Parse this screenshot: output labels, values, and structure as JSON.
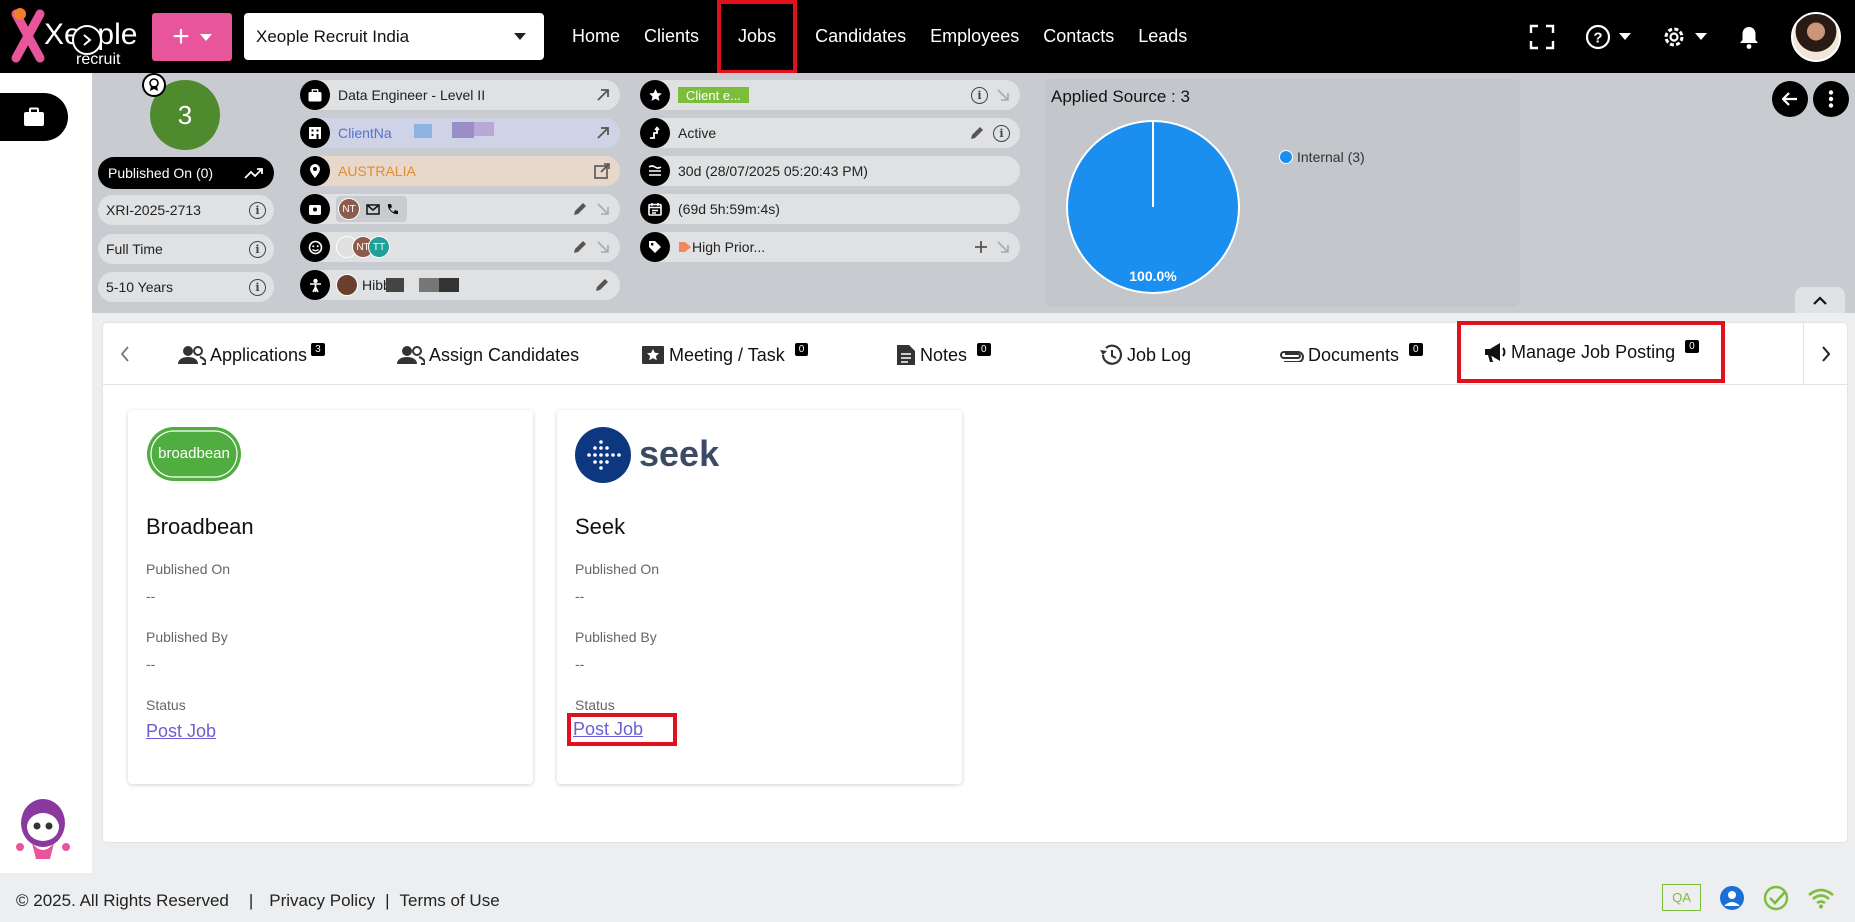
{
  "header": {
    "logo_text": "Xeople",
    "logo_sub": "recruit",
    "org_select": "Xeople Recruit India",
    "nav": [
      "Home",
      "Clients",
      "Jobs",
      "Candidates",
      "Employees",
      "Contacts",
      "Leads"
    ],
    "active_nav": "Jobs"
  },
  "summary": {
    "score": "3",
    "published_on": "Published On (0)",
    "job_code": "XRI-2025-2713",
    "job_type": "Full Time",
    "experience": "5-10 Years",
    "job_title": "Data Engineer - Level II",
    "client_name": "ClientNa",
    "location": "AUSTRALIA",
    "owner_chip": "NT",
    "team_chips": [
      "NT",
      "TT"
    ],
    "contact_name": "Hibb",
    "client_engagement": "Client e...",
    "status": "Active",
    "age": "30d (28/07/2025 05:20:43 PM)",
    "duration": "(69d 5h:59m:4s)",
    "priority": "High Prior...",
    "chart_title": "Applied Source : 3"
  },
  "chart_data": {
    "type": "pie",
    "title": "Applied Source : 3",
    "labels": [
      "Internal (3)"
    ],
    "values": [
      3
    ],
    "percent_labels": [
      "100.0%"
    ],
    "colors": [
      "#1a8ff0"
    ],
    "legend_position": "right"
  },
  "tabs": [
    {
      "label": "Applications",
      "count": "3"
    },
    {
      "label": "Assign Candidates",
      "count": ""
    },
    {
      "label": "Meeting / Task",
      "count": "0"
    },
    {
      "label": "Notes",
      "count": "0"
    },
    {
      "label": "Job Log",
      "count": ""
    },
    {
      "label": "Documents",
      "count": "0"
    },
    {
      "label": "Manage Job Posting",
      "count": "0"
    }
  ],
  "boards": [
    {
      "name": "Broadbean",
      "logo_text": "broadbean",
      "published_on_label": "Published On",
      "published_on": "--",
      "published_by_label": "Published By",
      "published_by": "--",
      "status_label": "Status",
      "status": "Post Job"
    },
    {
      "name": "Seek",
      "logo_text": "seek",
      "published_on_label": "Published On",
      "published_on": "--",
      "published_by_label": "Published By",
      "published_by": "--",
      "status_label": "Status",
      "status": "Post Job"
    }
  ],
  "footer": {
    "copyright": "© 2025. All Rights Reserved",
    "sep": "|",
    "privacy": "Privacy Policy",
    "terms": "Terms of Use",
    "env_badge": "QA"
  },
  "colors": {
    "brand_pink": "#e8559a",
    "active_outline": "#e0101f",
    "link_purple": "#6c5fd6",
    "pie_blue": "#1a8ff0",
    "score_green": "#4f8a2e"
  }
}
